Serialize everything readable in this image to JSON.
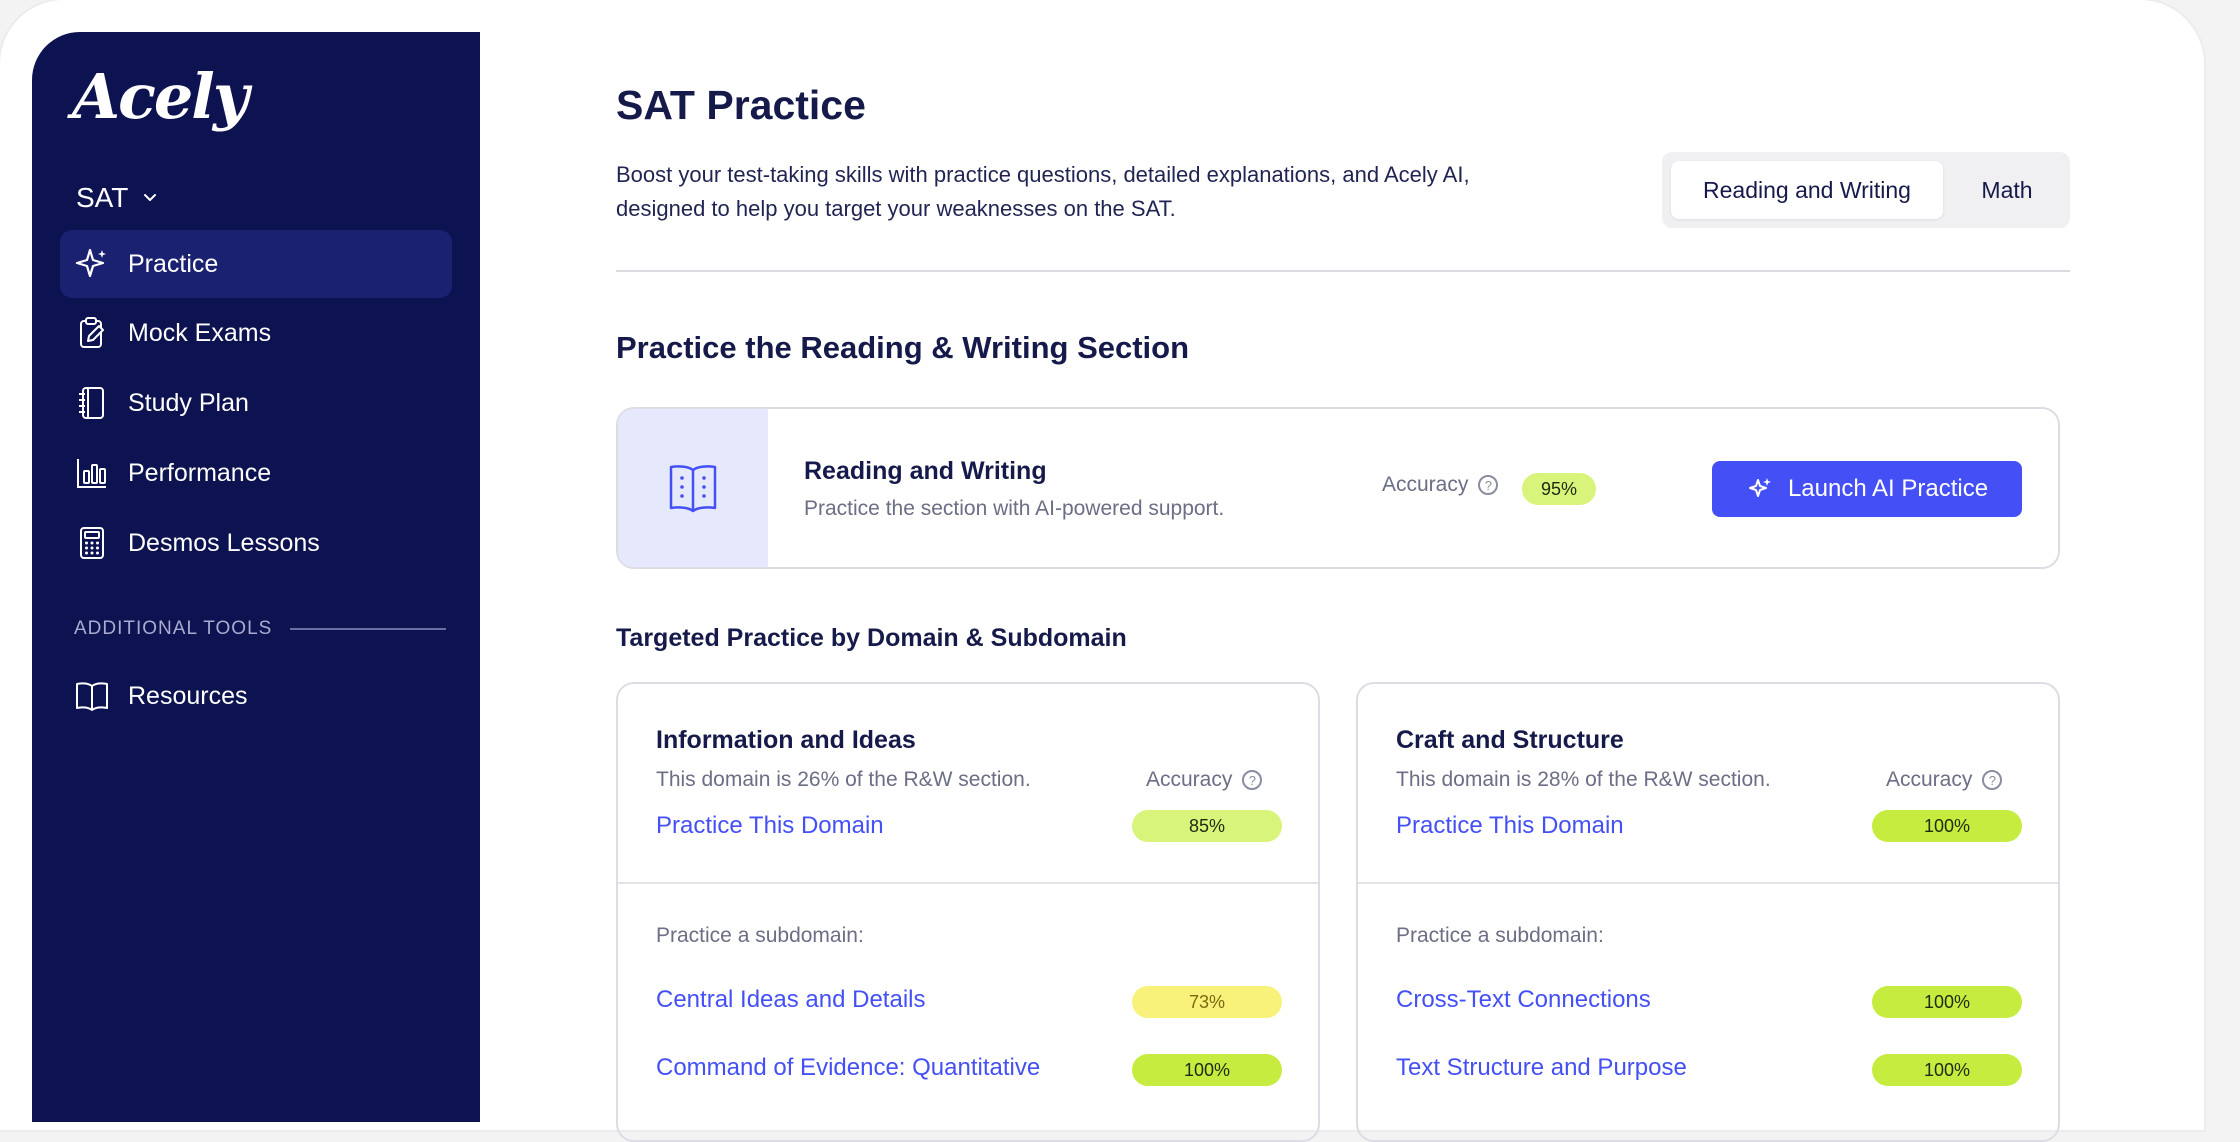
{
  "brand": {
    "logo_text": "Acely"
  },
  "sidebar": {
    "exam": "SAT",
    "items": [
      {
        "label": "Practice",
        "icon": "sparkle-icon",
        "active": true
      },
      {
        "label": "Mock Exams",
        "icon": "clipboard-icon",
        "active": false
      },
      {
        "label": "Study Plan",
        "icon": "notebook-icon",
        "active": false
      },
      {
        "label": "Performance",
        "icon": "bar-chart-icon",
        "active": false
      },
      {
        "label": "Desmos Lessons",
        "icon": "calculator-icon",
        "active": false
      }
    ],
    "tools_label": "ADDITIONAL TOOLS",
    "tools": [
      {
        "label": "Resources",
        "icon": "book-icon"
      }
    ]
  },
  "header": {
    "title": "SAT Practice",
    "description": "Boost your test-taking skills with practice questions, detailed explanations, and Acely AI, designed to help you target your weaknesses on the SAT.",
    "tabs": [
      {
        "label": "Reading and Writing",
        "selected": true
      },
      {
        "label": "Math",
        "selected": false
      }
    ]
  },
  "section": {
    "title": "Practice the Reading & Writing Section",
    "card": {
      "title": "Reading and Writing",
      "subtitle": "Practice the section with AI-powered support.",
      "accuracy_label": "Accuracy",
      "accuracy": "95%",
      "launch_label": "Launch AI Practice"
    }
  },
  "targeted": {
    "title": "Targeted Practice by Domain & Subdomain",
    "domains": [
      {
        "title": "Information and Ideas",
        "share": "This domain is 26% of the R&W section.",
        "accuracy_label": "Accuracy",
        "practice_label": "Practice This Domain",
        "accuracy": "85%",
        "subdomain_label": "Practice a subdomain:",
        "subdomains": [
          {
            "label": "Central Ideas and Details",
            "accuracy": "73%"
          },
          {
            "label": "Command of Evidence: Quantitative",
            "accuracy": "100%"
          }
        ]
      },
      {
        "title": "Craft and Structure",
        "share": "This domain is 28% of the R&W section.",
        "accuracy_label": "Accuracy",
        "practice_label": "Practice This Domain",
        "accuracy": "100%",
        "subdomain_label": "Practice a subdomain:",
        "subdomains": [
          {
            "label": "Cross-Text Connections",
            "accuracy": "100%"
          },
          {
            "label": "Text Structure and Purpose",
            "accuracy": "100%"
          }
        ]
      }
    ]
  },
  "colors": {
    "sidebar_bg": "#0d1250",
    "accent": "#4450f5",
    "pill_green": "#c6ec3f",
    "pill_light_green": "#d9f47a",
    "pill_yellow": "#f8f17a"
  }
}
